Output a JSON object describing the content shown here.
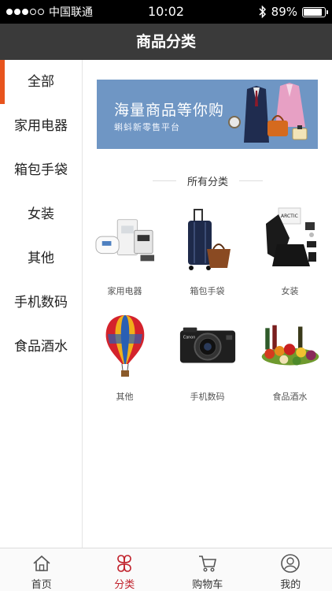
{
  "status_bar": {
    "carrier": "中国联通",
    "time": "10:02",
    "battery_percent": "89%",
    "battery_level": 0.89
  },
  "nav": {
    "title": "商品分类"
  },
  "sidebar": {
    "items": [
      {
        "label": "全部",
        "active": true
      },
      {
        "label": "家用电器",
        "active": false
      },
      {
        "label": "箱包手袋",
        "active": false
      },
      {
        "label": "女装",
        "active": false
      },
      {
        "label": "其他",
        "active": false
      },
      {
        "label": "手机数码",
        "active": false
      },
      {
        "label": "食品酒水",
        "active": false
      }
    ],
    "accent_color": "#e8541d"
  },
  "banner": {
    "title": "海量商品等你购",
    "subtitle": "蝌蚪新零售平台"
  },
  "section": {
    "title": "所有分类"
  },
  "categories": [
    {
      "label": "家用电器",
      "icon": "appliances-image"
    },
    {
      "label": "箱包手袋",
      "icon": "luggage-image"
    },
    {
      "label": "女装",
      "icon": "womens-clothing-image"
    },
    {
      "label": "其他",
      "icon": "hot-air-balloon-image"
    },
    {
      "label": "手机数码",
      "icon": "camera-image"
    },
    {
      "label": "食品酒水",
      "icon": "food-drinks-image"
    }
  ],
  "tab_bar": {
    "tabs": [
      {
        "label": "首页",
        "icon": "home-icon",
        "active": false
      },
      {
        "label": "分类",
        "icon": "category-icon",
        "active": true
      },
      {
        "label": "购物车",
        "icon": "cart-icon",
        "active": false
      },
      {
        "label": "我的",
        "icon": "profile-icon",
        "active": false
      }
    ],
    "active_color": "#c0202a"
  }
}
